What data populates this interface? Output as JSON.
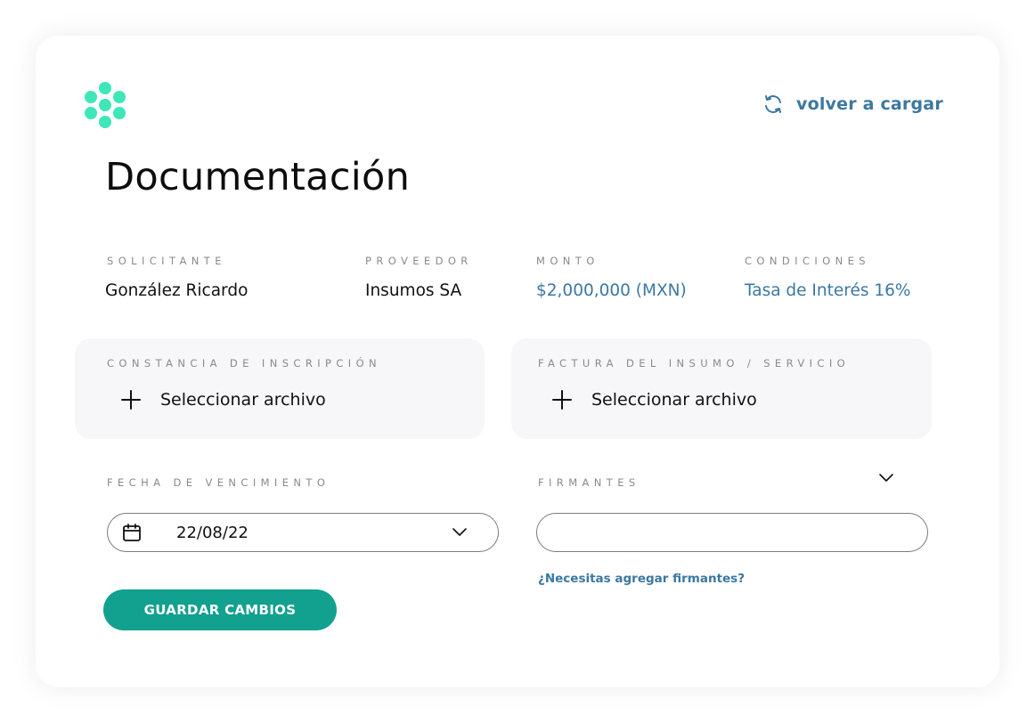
{
  "header": {
    "logo_icon": "dots-flower-logo",
    "reload_icon": "refresh-icon",
    "reload_label": "volver a cargar"
  },
  "page": {
    "title": "Documentación"
  },
  "summary": {
    "solicitante": {
      "label": "SOLICITANTE",
      "value": "González Ricardo"
    },
    "proveedor": {
      "label": "PROVEEDOR",
      "value": "Insumos SA"
    },
    "monto": {
      "label": "MONTO",
      "value": "$2,000,000 (MXN)"
    },
    "condiciones": {
      "label": "CONDICIONES",
      "value": "Tasa de Interés 16%"
    }
  },
  "uploads": {
    "constancia": {
      "label": "CONSTANCIA DE INSCRIPCIÓN",
      "action": "Seleccionar archivo"
    },
    "factura": {
      "label": "FACTURA DEL INSUMO / SERVICIO",
      "action": "Seleccionar archivo"
    }
  },
  "form": {
    "fecha": {
      "label": "FECHA DE VENCIMIENTO",
      "value": "22/08/22"
    },
    "firmantes": {
      "label": "FIRMANTES",
      "value": ""
    },
    "help_link": "¿Necesitas agregar firmantes?",
    "save_label": "GUARDAR CAMBIOS"
  },
  "colors": {
    "accent_teal": "#12a08f",
    "logo_mint": "#3ee6b8",
    "link_blue": "#3b78a1",
    "upload_bg": "#f7f7f9"
  }
}
